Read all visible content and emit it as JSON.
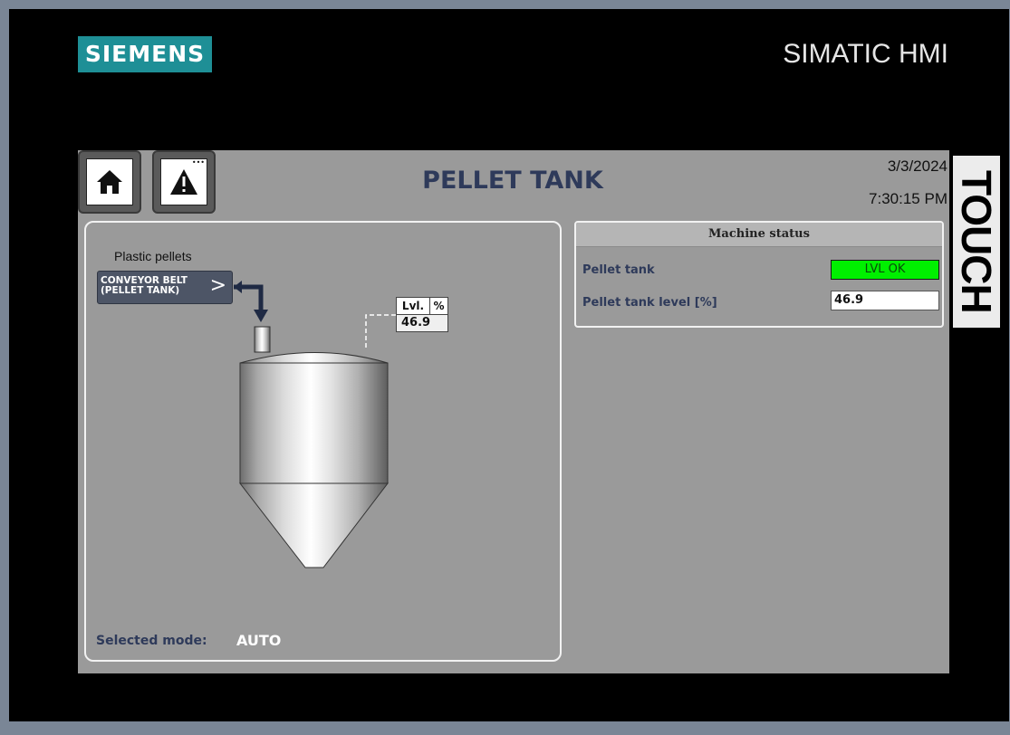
{
  "hmi": {
    "brand": "SIEMENS",
    "title": "SIMATIC HMI",
    "side_label": "TOUCH"
  },
  "screen": {
    "title": "PELLET TANK",
    "date": "3/3/2024",
    "time": "7:30:15 PM"
  },
  "nav": {
    "home_icon": "home-icon",
    "alarm_icon": "warning-icon"
  },
  "process": {
    "pellets_label": "Plastic pellets",
    "conveyor_line1": "CONVEYOR BELT",
    "conveyor_line2": "(PELLET TANK)",
    "conveyor_chevron": ">",
    "level_title": "Lvl.",
    "level_unit": "%",
    "level_value": "46.9",
    "mode_label": "Selected mode:",
    "mode_value": "AUTO"
  },
  "machine_status": {
    "header": "Machine status",
    "pellet_tank_label": "Pellet tank",
    "pellet_tank_status": "LVL OK",
    "pellet_tank_level_label": "Pellet tank level [%]",
    "pellet_tank_level_value": "46.9"
  },
  "colors": {
    "bezel": "#000000",
    "screen_background": "#9a9a9a",
    "siemens_teal": "#1e8f96",
    "title_navy": "#2e3a5a",
    "status_ok_green": "#00f000",
    "pipe_navy": "#1f2a44"
  }
}
